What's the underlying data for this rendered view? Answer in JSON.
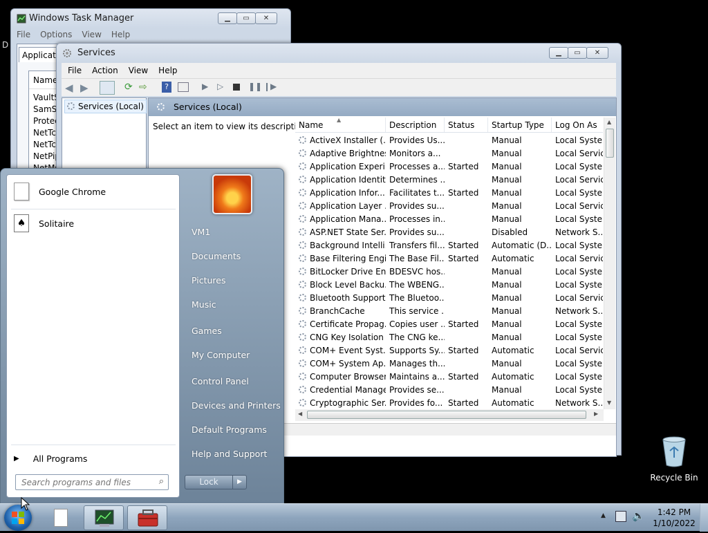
{
  "task_manager": {
    "title": "Windows Task Manager",
    "menu": [
      "File",
      "Options",
      "View",
      "Help"
    ],
    "tab_partial": "Application",
    "column_partial": "Name",
    "items": [
      "VaultS",
      "SamSs",
      "Protec",
      "NetTcp",
      "NetTcp",
      "NetPip",
      "NetMs"
    ]
  },
  "services": {
    "title": "Services",
    "menu": [
      "File",
      "Action",
      "View",
      "Help"
    ],
    "tree_item": "Services (Local)",
    "header_title": "Services (Local)",
    "description_prompt": "Select an item to view its description.",
    "columns": [
      "Name",
      "Description",
      "Status",
      "Startup Type",
      "Log On As"
    ],
    "rows": [
      {
        "name": "ActiveX Installer (...",
        "description": "Provides Us...",
        "status": "",
        "startup": "Manual",
        "logon": "Local Syste..."
      },
      {
        "name": "Adaptive Brightness",
        "description": "Monitors a...",
        "status": "",
        "startup": "Manual",
        "logon": "Local Service"
      },
      {
        "name": "Application Experi...",
        "description": "Processes a...",
        "status": "Started",
        "startup": "Manual",
        "logon": "Local Syste..."
      },
      {
        "name": "Application Identity",
        "description": "Determines ...",
        "status": "",
        "startup": "Manual",
        "logon": "Local Service"
      },
      {
        "name": "Application Infor...",
        "description": "Facilitates t...",
        "status": "Started",
        "startup": "Manual",
        "logon": "Local Syste..."
      },
      {
        "name": "Application Layer ...",
        "description": "Provides su...",
        "status": "",
        "startup": "Manual",
        "logon": "Local Service"
      },
      {
        "name": "Application Mana...",
        "description": "Processes in...",
        "status": "",
        "startup": "Manual",
        "logon": "Local Syste..."
      },
      {
        "name": "ASP.NET State Ser...",
        "description": "Provides su...",
        "status": "",
        "startup": "Disabled",
        "logon": "Network S..."
      },
      {
        "name": "Background Intelli...",
        "description": "Transfers fil...",
        "status": "Started",
        "startup": "Automatic (D...",
        "logon": "Local Syste..."
      },
      {
        "name": "Base Filtering Engi...",
        "description": "The Base Fil...",
        "status": "Started",
        "startup": "Automatic",
        "logon": "Local Service"
      },
      {
        "name": "BitLocker Drive En...",
        "description": "BDESVC hos...",
        "status": "",
        "startup": "Manual",
        "logon": "Local Syste..."
      },
      {
        "name": "Block Level Backu...",
        "description": "The WBENG...",
        "status": "",
        "startup": "Manual",
        "logon": "Local Syste..."
      },
      {
        "name": "Bluetooth Support...",
        "description": "The Bluetoo...",
        "status": "",
        "startup": "Manual",
        "logon": "Local Service"
      },
      {
        "name": "BranchCache",
        "description": "This service ...",
        "status": "",
        "startup": "Manual",
        "logon": "Network S..."
      },
      {
        "name": "Certificate Propag...",
        "description": "Copies user ...",
        "status": "Started",
        "startup": "Manual",
        "logon": "Local Syste..."
      },
      {
        "name": "CNG Key Isolation",
        "description": "The CNG ke...",
        "status": "",
        "startup": "Manual",
        "logon": "Local Syste..."
      },
      {
        "name": "COM+ Event Syst...",
        "description": "Supports Sy...",
        "status": "Started",
        "startup": "Automatic",
        "logon": "Local Service"
      },
      {
        "name": "COM+ System Ap...",
        "description": "Manages th...",
        "status": "",
        "startup": "Manual",
        "logon": "Local Syste..."
      },
      {
        "name": "Computer Browser",
        "description": "Maintains a...",
        "status": "Started",
        "startup": "Automatic",
        "logon": "Local Syste..."
      },
      {
        "name": "Credential Manager",
        "description": "Provides se...",
        "status": "",
        "startup": "Manual",
        "logon": "Local Syste..."
      },
      {
        "name": "Cryptographic Ser...",
        "description": "Provides fo...",
        "status": "Started",
        "startup": "Automatic",
        "logon": "Network S..."
      }
    ]
  },
  "start_menu": {
    "pinned": [
      {
        "label": "Google Chrome",
        "icon": "document-icon"
      },
      {
        "label": "Solitaire",
        "icon": "solitaire-icon"
      }
    ],
    "all_programs": "All Programs",
    "search_placeholder": "Search programs and files",
    "user_name": "VM1",
    "right_items": [
      "Documents",
      "Pictures",
      "Music",
      "Games",
      "My Computer",
      "Control Panel",
      "Devices and Printers",
      "Default Programs",
      "Help and Support"
    ],
    "lock_label": "Lock"
  },
  "desktop": {
    "recycle_bin": "Recycle Bin",
    "edge_char": "D"
  },
  "taskbar": {
    "time": "1:42 PM",
    "date": "1/10/2022"
  }
}
